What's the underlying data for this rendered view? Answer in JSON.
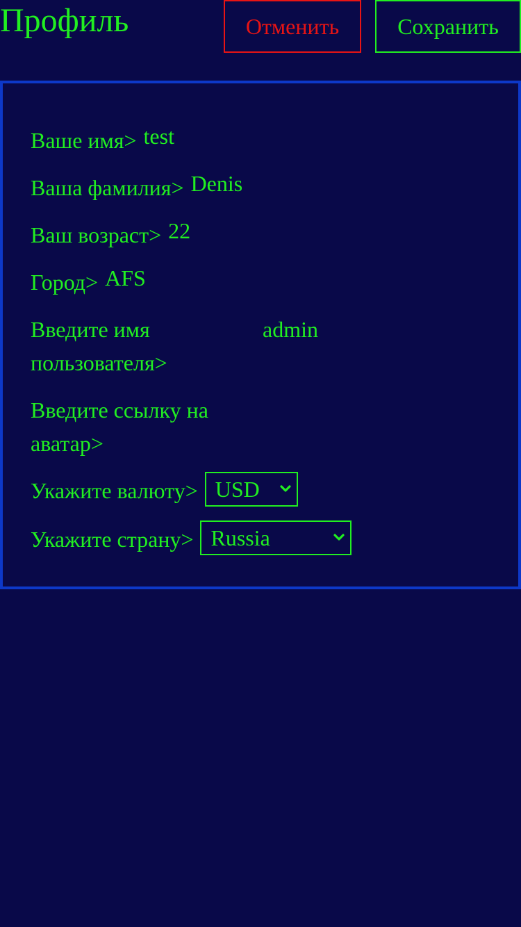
{
  "header": {
    "title": "Профиль",
    "cancel_label": "Отменить",
    "save_label": "Сохранить"
  },
  "form": {
    "first_name": {
      "label": "Ваше имя>",
      "value": "test"
    },
    "last_name": {
      "label": "Ваша фамилия>",
      "value": "Denis"
    },
    "age": {
      "label": "Ваш возраст>",
      "value": "22"
    },
    "city": {
      "label": "Город>",
      "value": "AFS"
    },
    "username": {
      "label": "Введите имя пользователя>",
      "value": "admin"
    },
    "avatar": {
      "label": "Введите ссылку на аватар>",
      "value": ""
    },
    "currency": {
      "label": "Укажите валюту>",
      "selected": "USD"
    },
    "country": {
      "label": "Укажите страну>",
      "selected": "Russia"
    }
  },
  "colors": {
    "background": "#090949",
    "text": "#21ef21",
    "cancel": "#e81414",
    "card_border": "#0d38c8"
  },
  "icons": {
    "select_arrow": "chevron-down-icon"
  }
}
